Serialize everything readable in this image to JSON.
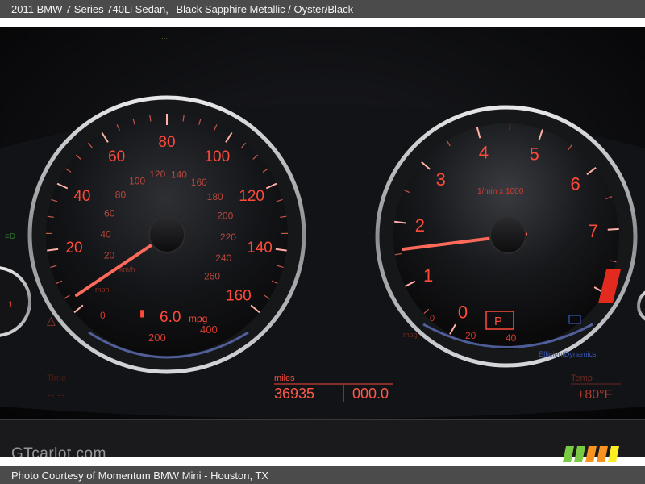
{
  "header": {
    "vehicle": "2011 BMW 7 Series 740Li Sedan,",
    "colors": "Black Sapphire Metallic / Oyster/Black"
  },
  "footer": {
    "credit": "Photo Courtesy of Momentum BMW Mini - Houston, TX"
  },
  "watermark": "GTcarlot.com",
  "speedometer": {
    "mph_labels": [
      "20",
      "40",
      "60",
      "80",
      "100",
      "120",
      "140",
      "160"
    ],
    "kmh_labels": [
      "20",
      "40",
      "60",
      "80",
      "100",
      "120",
      "140",
      "160",
      "180",
      "200",
      "220",
      "240",
      "260"
    ],
    "unit_kmh": "km/h",
    "unit_mph": "mph"
  },
  "economy": {
    "value": "6.0",
    "unit": "mpg",
    "scale": [
      "0",
      "200",
      "400"
    ]
  },
  "tachometer": {
    "labels": [
      "0",
      "1",
      "2",
      "3",
      "4",
      "5",
      "6",
      "7"
    ],
    "unit": "1/min x 1000",
    "gear": "P",
    "scale": [
      "0",
      "20",
      "40"
    ],
    "efficient": "EfficientDynamics",
    "mpg_label": "mpg"
  },
  "odometer": {
    "unit": "miles",
    "total": "36935",
    "trip": "000.0"
  },
  "left_info": {
    "label": "Time",
    "value": "--:--"
  },
  "temperature": {
    "label": "Temp",
    "value": "+80°F"
  },
  "colors": {
    "accent": "#ff4a3a",
    "needle": "#ff6a5a",
    "bar": "#4b4b4b",
    "eco": "#6a7fd0"
  }
}
